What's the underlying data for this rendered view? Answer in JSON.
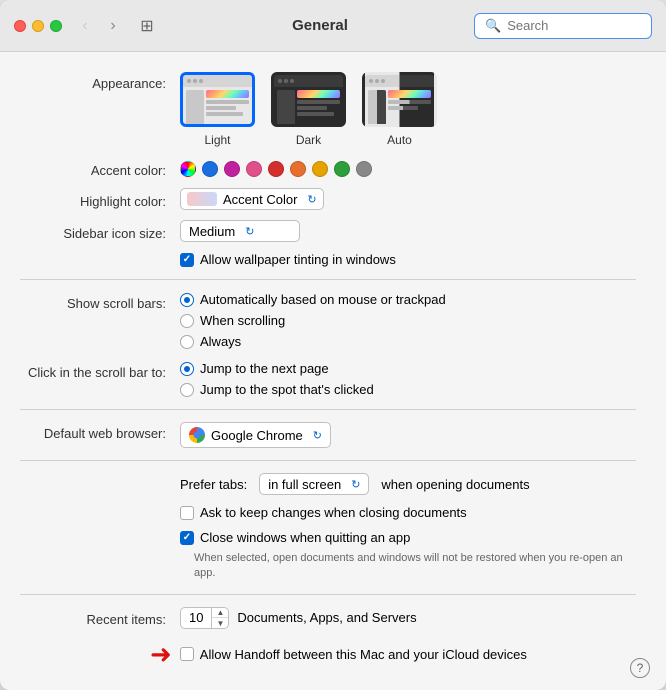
{
  "window": {
    "title": "General"
  },
  "search": {
    "placeholder": "Search"
  },
  "appearance": {
    "label": "Appearance:",
    "options": [
      {
        "id": "light",
        "label": "Light",
        "selected": true
      },
      {
        "id": "dark",
        "label": "Dark",
        "selected": false
      },
      {
        "id": "auto",
        "label": "Auto",
        "selected": false
      }
    ]
  },
  "accent_color": {
    "label": "Accent color:",
    "colors": [
      "#8e44ad",
      "#1a6ee0",
      "#c0219e",
      "#d42f2f",
      "#e76e2e",
      "#e6a300",
      "#2e9e3a",
      "#888888"
    ]
  },
  "highlight_color": {
    "label": "Highlight color:",
    "value": "Accent Color"
  },
  "sidebar_icon": {
    "label": "Sidebar icon size:",
    "value": "Medium"
  },
  "wallpaper_tinting": {
    "label": "Allow wallpaper tinting in windows",
    "checked": true
  },
  "scroll_bars": {
    "label": "Show scroll bars:",
    "options": [
      {
        "id": "auto",
        "label": "Automatically based on mouse or trackpad",
        "selected": true
      },
      {
        "id": "scrolling",
        "label": "When scrolling",
        "selected": false
      },
      {
        "id": "always",
        "label": "Always",
        "selected": false
      }
    ]
  },
  "scroll_bar_click": {
    "label": "Click in the scroll bar to:",
    "options": [
      {
        "id": "next-page",
        "label": "Jump to the next page",
        "selected": true
      },
      {
        "id": "clicked-spot",
        "label": "Jump to the spot that's clicked",
        "selected": false
      }
    ]
  },
  "default_browser": {
    "label": "Default web browser:",
    "value": "Google Chrome"
  },
  "prefer_tabs": {
    "label": "Prefer tabs:",
    "value": "in full screen",
    "suffix": "when opening documents"
  },
  "keep_changes": {
    "label": "Ask to keep changes when closing documents",
    "checked": false
  },
  "close_windows": {
    "label": "Close windows when quitting an app",
    "checked": true
  },
  "close_windows_note": "When selected, open documents and windows will not be restored\nwhen you re-open an app.",
  "recent_items": {
    "label": "Recent items:",
    "value": "10",
    "suffix": "Documents, Apps, and Servers"
  },
  "handoff": {
    "label": "Allow Handoff between this Mac and your iCloud devices",
    "checked": false
  },
  "help": {
    "label": "?"
  }
}
